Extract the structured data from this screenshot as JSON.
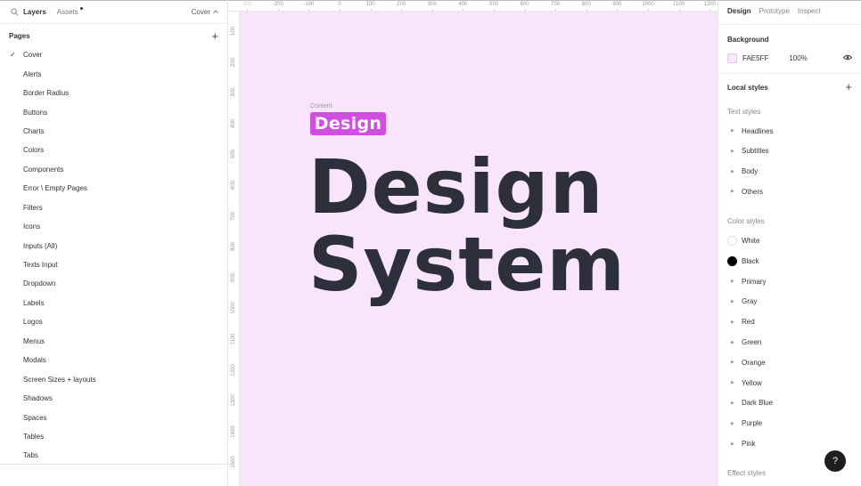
{
  "left_panel": {
    "tab_layers": "Layers",
    "tab_assets": "Assets",
    "current_page": "Cover",
    "pages_title": "Pages",
    "pages": [
      "Cover",
      "Alerts",
      "Border Radius",
      "Buttons",
      "Charts",
      "Colors",
      "Components",
      "Error \\ Empty Pages",
      "Filters",
      "Icons",
      "Inputs (All)",
      "Texts Input",
      "Dropdown",
      "Labels",
      "Logos",
      "Menus",
      "Modals",
      "Screen Sizes + layouts",
      "Shadows",
      "Spaces",
      "Tables",
      "Tabs"
    ]
  },
  "canvas": {
    "background": "#F8E5FB",
    "ruler_top": [
      "-300",
      "-200",
      "-100",
      "0",
      "100",
      "200",
      "300",
      "400",
      "500",
      "600",
      "700",
      "800",
      "900",
      "1000",
      "1100",
      "1200"
    ],
    "ruler_left": [
      "100",
      "200",
      "300",
      "400",
      "500",
      "600",
      "700",
      "800",
      "900",
      "1000",
      "1100",
      "1200",
      "1300",
      "1400",
      "1500"
    ],
    "frame_label": "Content",
    "badge_text": "Design",
    "badge_color": "#D04FE0",
    "title_line1": "Design",
    "title_line2": "System",
    "title_color": "#2D2F3B"
  },
  "right_panel": {
    "tabs": [
      "Design",
      "Prototype",
      "Inspect"
    ],
    "background_title": "Background",
    "background_hex": "FAE5FF",
    "background_opacity": "100%",
    "local_styles_title": "Local styles",
    "text_styles_title": "Text styles",
    "text_styles": [
      "Headlines",
      "Subtitles",
      "Body",
      "Others"
    ],
    "color_styles_title": "Color styles",
    "color_styles": [
      {
        "name": "White",
        "swatch": "#FFFFFF"
      },
      {
        "name": "Black",
        "swatch": "#000000"
      },
      {
        "name": "Primary"
      },
      {
        "name": "Gray"
      },
      {
        "name": "Red"
      },
      {
        "name": "Green"
      },
      {
        "name": "Orange"
      },
      {
        "name": "Yellow"
      },
      {
        "name": "Dark Blue"
      },
      {
        "name": "Purple"
      },
      {
        "name": "Pink"
      }
    ],
    "effect_styles_title": "Effect styles"
  },
  "help_button": "?"
}
